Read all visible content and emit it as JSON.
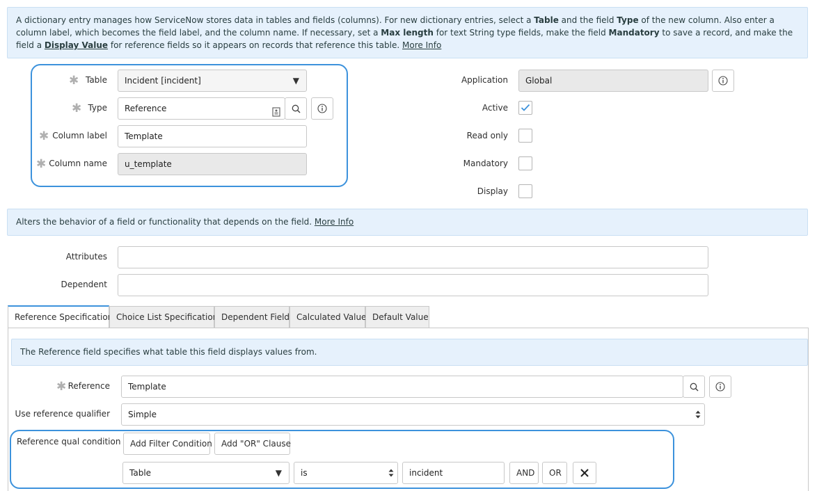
{
  "top_info": {
    "p1": "A dictionary entry manages how ServiceNow stores data in tables and fields (columns). For new dictionary entries, select a ",
    "table_word": "Table",
    "p2": " and the field ",
    "type_word": "Type",
    "p3": " of the new column. Also enter a column label, which becomes the field label, and the column name. If necessary, set a ",
    "maxlen_word": "Max length",
    "p4": " for text String type fields, make the field ",
    "mandatory_word": "Mandatory",
    "p5": " to save a record, and make the field a ",
    "display_link": "Display Value",
    "p6": " for reference fields so it appears on records that reference this table. ",
    "more_info": "More Info"
  },
  "form": {
    "table": {
      "label": "Table",
      "value": "Incident [incident]"
    },
    "type": {
      "label": "Type",
      "value": "Reference"
    },
    "column_label": {
      "label": "Column label",
      "value": "Template"
    },
    "column_name": {
      "label": "Column name",
      "value": "u_template"
    },
    "application": {
      "label": "Application",
      "value": "Global"
    },
    "active": {
      "label": "Active",
      "checked": true
    },
    "read_only": {
      "label": "Read only",
      "checked": false
    },
    "mandatory": {
      "label": "Mandatory",
      "checked": false
    },
    "display": {
      "label": "Display",
      "checked": false
    }
  },
  "alters_info": {
    "text": "Alters the behavior of a field or functionality that depends on the field. ",
    "more_info": "More Info"
  },
  "attributes": {
    "label": "Attributes",
    "value": ""
  },
  "dependent": {
    "label": "Dependent",
    "value": ""
  },
  "tabs": [
    {
      "label": "Reference Specification",
      "active": true
    },
    {
      "label": "Choice List Specification",
      "active": false
    },
    {
      "label": "Dependent Field",
      "active": false
    },
    {
      "label": "Calculated Value",
      "active": false
    },
    {
      "label": "Default Value",
      "active": false
    }
  ],
  "ref_spec": {
    "info": "The Reference field specifies what table this field displays values from.",
    "reference": {
      "label": "Reference",
      "value": "Template"
    },
    "qualifier": {
      "label": "Use reference qualifier",
      "value": "Simple"
    },
    "qual_condition": {
      "label": "Reference qual condition",
      "add_filter": "Add Filter Condition",
      "add_or": "Add \"OR\" Clause",
      "field": "Table",
      "operator": "is",
      "value": "incident",
      "and": "AND",
      "or": "OR"
    }
  },
  "colors": {
    "accent": "#3c92dc",
    "info_bg": "#e6f1fc",
    "readonly_bg": "#e9e9e9"
  }
}
